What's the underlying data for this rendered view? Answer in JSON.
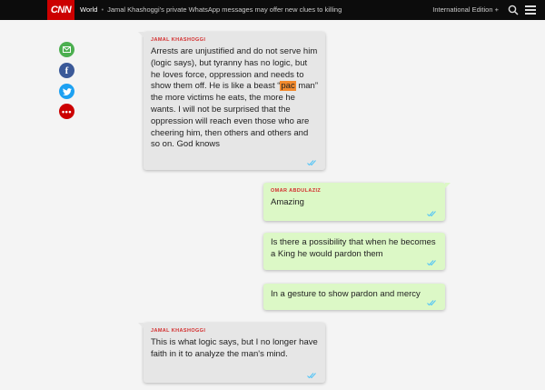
{
  "header": {
    "logo": "CNN",
    "section": "World",
    "separator": "•",
    "headline": "Jamal Khashoggi’s private WhatsApp messages may offer new clues to killing",
    "edition": "International Edition +"
  },
  "share": {
    "icons": [
      "email-icon",
      "facebook-icon",
      "twitter-icon",
      "more-icon"
    ],
    "facebook_glyph": "f",
    "more_glyph": "•••"
  },
  "messages": [
    {
      "sender": "JAMAL KHASHOGGI",
      "text_before": "Arrests are unjustified and do not serve him (logic says), but tyranny has no logic, but he loves force, oppression and needs to show them off. He is like a beast “",
      "highlight": "pac",
      "text_after": " man” the more victims he eats, the more he wants. I will not be surprised that the oppression will reach even those who are cheering him, then others and others and so on. God knows",
      "status": "read"
    },
    {
      "sender": "OMAR ABDULAZIZ",
      "text": "Amazing",
      "status": "read"
    },
    {
      "text": "Is there a possibility that when he becomes a King he would pardon them",
      "status": "read"
    },
    {
      "text": "In a gesture to show pardon and mercy",
      "status": "read"
    },
    {
      "sender": "JAMAL KHASHOGGI",
      "text": "This is what logic says, but I no longer have faith in it to analyze the man's mind.",
      "status": "read"
    }
  ],
  "colors": {
    "topbar": "#0c0c0c",
    "brand": "#cc0000",
    "gray_bubble": "#e6e6e6",
    "green_bubble": "#dcf8c6",
    "sender": "#d32f2f",
    "ticks": "#4fc3f7"
  }
}
